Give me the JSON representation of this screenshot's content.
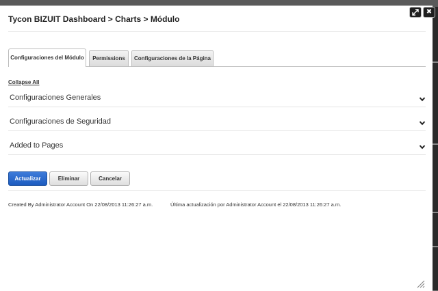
{
  "breadcrumb": "Tycon BIZUIT Dashboard > Charts > Módulo",
  "window_controls": {
    "maximize_icon": "expand-arrows-icon",
    "close_icon": "close-icon",
    "close_glyph": "✖"
  },
  "tabs": [
    {
      "label": "Configuraciones del Módulo",
      "active": true
    },
    {
      "label": "Permissions",
      "active": false
    },
    {
      "label": "Configuraciones de la Página",
      "active": false
    }
  ],
  "collapse_all": "Collapse All",
  "sections": [
    {
      "label": "Configuraciones Generales"
    },
    {
      "label": "Configuraciones de Seguridad"
    },
    {
      "label": "Added to Pages"
    }
  ],
  "buttons": {
    "update": "Actualizar",
    "delete": "Eliminar",
    "cancel": "Cancelar"
  },
  "meta": {
    "created": "Created By Administrator Account On 22/08/2013 11:26:27 a.m.",
    "updated": "Última actualización por Administrator Account el 22/08/2013 11:26:27 a.m."
  },
  "colors": {
    "primary": "#2161c6",
    "text": "#333333",
    "overlay": "#6f6f6f"
  }
}
